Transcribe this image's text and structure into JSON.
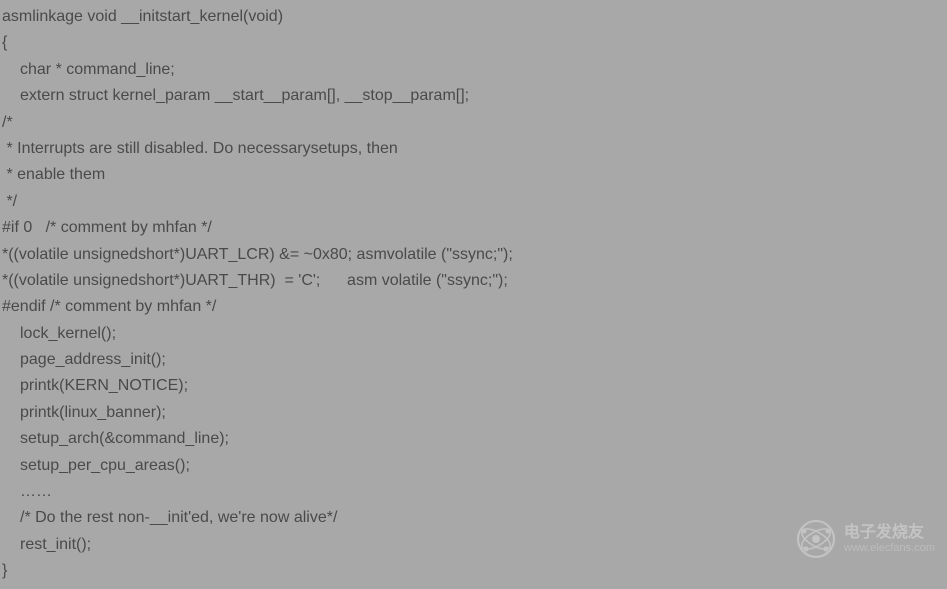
{
  "code": {
    "lines": [
      {
        "text": "asmlinkage void __initstart_kernel(void)",
        "indent": 0
      },
      {
        "text": "{",
        "indent": 0
      },
      {
        "text": "char * command_line;",
        "indent": 1
      },
      {
        "text": "extern struct kernel_param __start__param[], __stop__param[];",
        "indent": 1
      },
      {
        "text": "/*",
        "indent": 0
      },
      {
        "text": " * Interrupts are still disabled. Do necessarysetups, then",
        "indent": 0
      },
      {
        "text": " * enable them",
        "indent": 0
      },
      {
        "text": " */",
        "indent": 0
      },
      {
        "text": "#if 0   /* comment by mhfan */",
        "indent": 0
      },
      {
        "text": "*((volatile unsignedshort*)UART_LCR) &= ~0x80; asmvolatile (\"ssync;\");",
        "indent": 0
      },
      {
        "text": "*((volatile unsignedshort*)UART_THR)  = 'C';      asm volatile (\"ssync;\");",
        "indent": 0
      },
      {
        "text": "#endif /* comment by mhfan */",
        "indent": 0
      },
      {
        "text": "lock_kernel();",
        "indent": 1
      },
      {
        "text": "page_address_init();",
        "indent": 1
      },
      {
        "text": "printk(KERN_NOTICE);",
        "indent": 1
      },
      {
        "text": "printk(linux_banner);",
        "indent": 1
      },
      {
        "text": "setup_arch(&command_line);",
        "indent": 1
      },
      {
        "text": "setup_per_cpu_areas();",
        "indent": 1
      },
      {
        "text": "……",
        "indent": 1
      },
      {
        "text": "/* Do the rest non-__init'ed, we're now alive*/",
        "indent": 1
      },
      {
        "text": "rest_init();",
        "indent": 1
      },
      {
        "text": "}",
        "indent": 0
      }
    ]
  },
  "watermark": {
    "cn": "电子发烧友",
    "en": "www.elecfans.com"
  }
}
